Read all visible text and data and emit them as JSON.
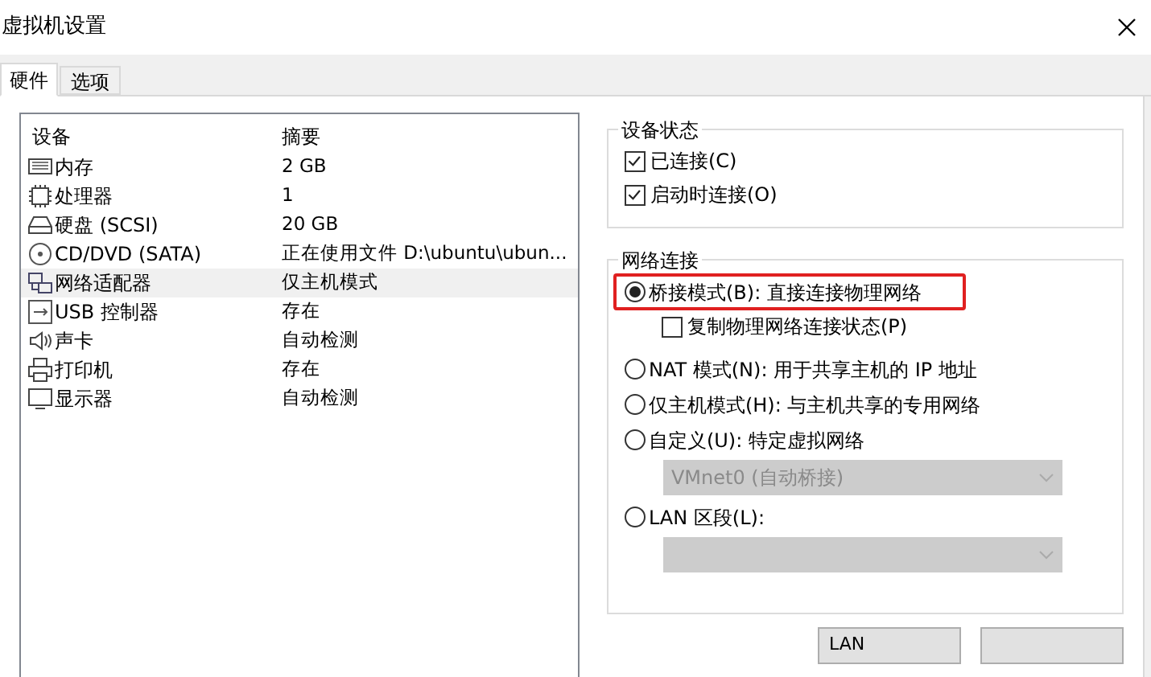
{
  "window": {
    "title": "虚拟机设置"
  },
  "tabs": [
    {
      "label": "硬件",
      "selected": true
    },
    {
      "label": "选项",
      "selected": false
    }
  ],
  "devices": {
    "columns": [
      "设备",
      "摘要"
    ],
    "rows": [
      {
        "device": "内存",
        "summary": "2 GB",
        "selected": false
      },
      {
        "device": "处理器",
        "summary": "1",
        "selected": false
      },
      {
        "device": "硬盘 (SCSI)",
        "summary": "20 GB",
        "selected": false
      },
      {
        "device": "CD/DVD (SATA)",
        "summary": "正在使用文件 D:\\ubuntu\\ubun...",
        "selected": false
      },
      {
        "device": "网络适配器",
        "summary": "仅主机模式",
        "selected": true
      },
      {
        "device": "USB 控制器",
        "summary": "存在",
        "selected": false
      },
      {
        "device": "声卡",
        "summary": "自动检测",
        "selected": false
      },
      {
        "device": "打印机",
        "summary": "存在",
        "selected": false
      },
      {
        "device": "显示器",
        "summary": "自动检测",
        "selected": false
      }
    ]
  },
  "device_status": {
    "title": "设备状态",
    "options": [
      {
        "label": "已连接(C)",
        "checked": true
      },
      {
        "label": "启动时连接(O)",
        "checked": true
      }
    ]
  },
  "network_connection": {
    "title": "网络连接",
    "options": [
      {
        "kind": "radio",
        "label": "桥接模式(B): 直接连接物理网络",
        "selected": true,
        "highlighted": true
      },
      {
        "kind": "checkbox",
        "label": "复制物理网络连接状态(P)",
        "checked": false
      },
      {
        "kind": "radio",
        "label": "NAT 模式(N): 用于共享主机的 IP 地址",
        "selected": false
      },
      {
        "kind": "radio",
        "label": "仅主机模式(H): 与主机共享的专用网络",
        "selected": false
      },
      {
        "kind": "radio",
        "label": "自定义(U): 特定虚拟网络",
        "selected": false
      },
      {
        "kind": "dropdown",
        "value": "VMnet0 (自动桥接)",
        "disabled": true
      },
      {
        "kind": "radio",
        "label": "LAN 区段(L):",
        "selected": false
      },
      {
        "kind": "dropdown",
        "disabled": true
      }
    ]
  },
  "buttons": [
    {
      "label": "LAN"
    }
  ]
}
